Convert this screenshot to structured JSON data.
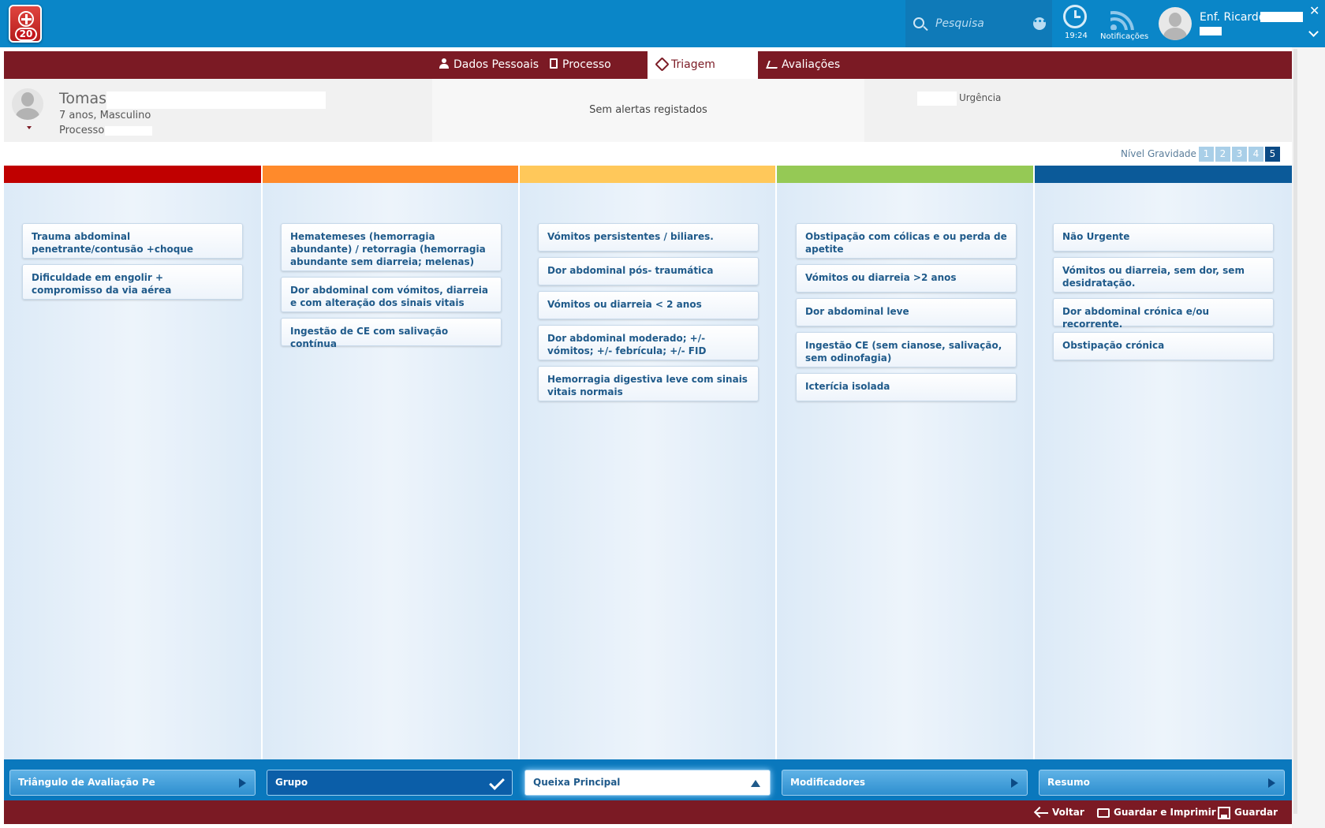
{
  "app": {
    "badge": "20"
  },
  "topbar": {
    "search_placeholder": "Pesquisa",
    "time": "19:24",
    "notifications_label": "Notificações",
    "user_name": "Enf. Ricardo"
  },
  "tabs": [
    {
      "label": "Dados Pessoais",
      "icon": "user-icon"
    },
    {
      "label": "Processo",
      "icon": "document-icon"
    },
    {
      "label": "Triagem",
      "icon": "tag-icon",
      "active": true
    },
    {
      "label": "Avaliações",
      "icon": "chart-icon"
    }
  ],
  "patient": {
    "name": "Tomas",
    "info": "7 anos, Masculino",
    "process_label": "Processo",
    "alerts": "Sem alertas registados",
    "episode_type": "Urgência"
  },
  "severity": {
    "label": "Nível Gravidade",
    "levels": [
      "1",
      "2",
      "3",
      "4",
      "5"
    ],
    "selected": "5"
  },
  "colors": {
    "level1": "#c00000",
    "level2": "#ff8a2b",
    "level3": "#ffc85a",
    "level4": "#95c955",
    "level5": "#0b5a99"
  },
  "columns": [
    {
      "items": [
        "Trauma abdominal penetrante/contusão +choque",
        "Dificuldade em engolir + compromisso da via aérea"
      ]
    },
    {
      "items": [
        "Hematemeses (hemorragia abundante) / retorragia (hemorragia abundante sem diarreia; melenas)",
        "Dor abdominal com vómitos, diarreia e com alteração dos sinais vitais",
        "Ingestão de CE com salivação contínua"
      ]
    },
    {
      "items": [
        "Vómitos persistentes / biliares.",
        "Dor abdominal pós- traumática",
        "Vómitos ou diarreia  < 2 anos",
        "Dor abdominal moderado; +/- vómitos; +/- febrícula; +/- FID",
        "Hemorragia digestiva leve com sinais vitais normais"
      ]
    },
    {
      "items": [
        "Obstipação com cólicas e ou perda de apetite",
        "Vómitos ou diarreia >2 anos",
        "Dor abdominal leve",
        "Ingestão CE (sem cianose, salivação, sem odinofagia)",
        "Icterícia isolada"
      ]
    },
    {
      "items": [
        "Não Urgente",
        "Vómitos ou diarreia, sem dor, sem desidratação.",
        "Dor abdominal crónica e/ou recorrente.",
        "Obstipação crónica"
      ]
    }
  ],
  "wizard": [
    {
      "label": "Triângulo de Avaliação Pe",
      "state": "next"
    },
    {
      "label": "Grupo",
      "state": "done"
    },
    {
      "label": "Queixa Principal",
      "state": "current"
    },
    {
      "label": "Modificadores",
      "state": "next"
    },
    {
      "label": "Resumo",
      "state": "next"
    }
  ],
  "actions": {
    "back": "Voltar",
    "save_print": "Guardar e Imprimir",
    "save": "Guardar"
  }
}
